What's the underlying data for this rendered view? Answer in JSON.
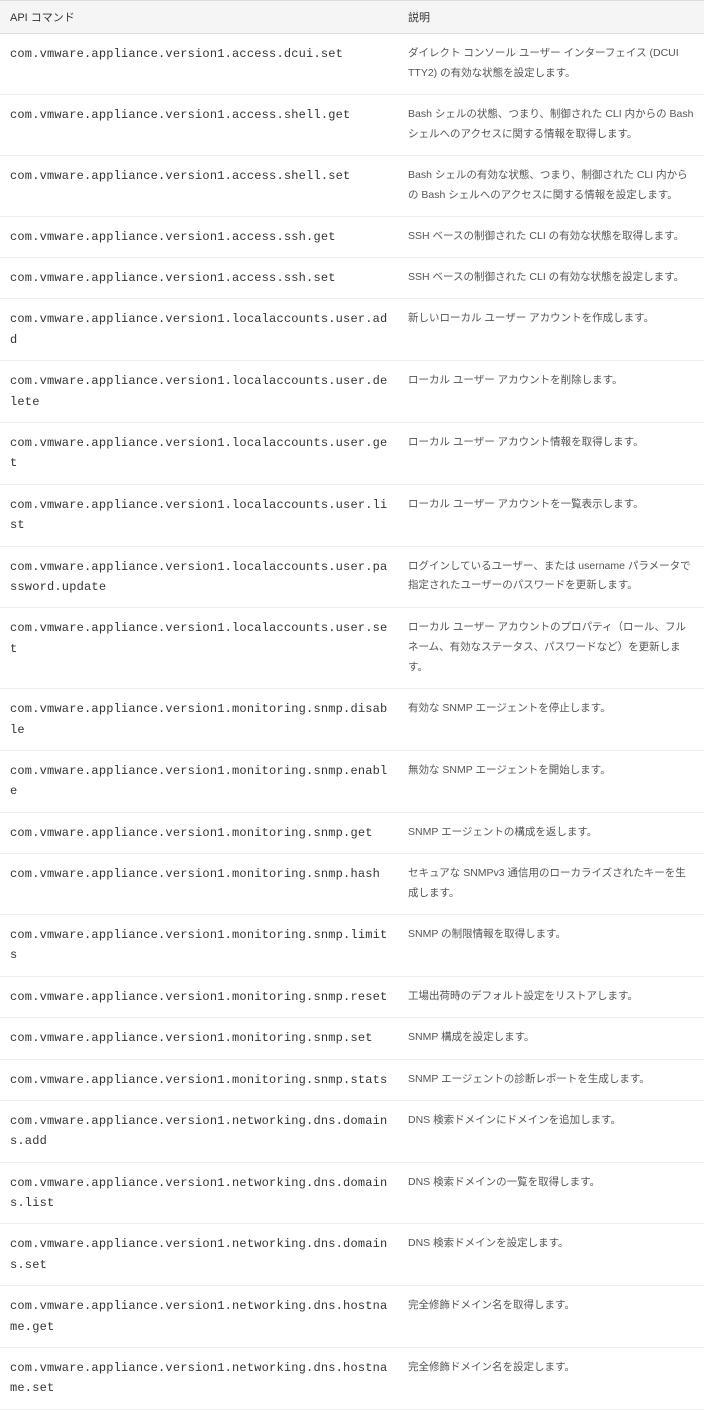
{
  "table": {
    "headers": {
      "command": "API コマンド",
      "description": "説明"
    },
    "rows": [
      {
        "command": "com.vmware.appliance.version1.access.dcui.set",
        "description": "ダイレクト コンソール ユーザー インターフェイス (DCUI TTY2) の有効な状態を設定します。"
      },
      {
        "command": "com.vmware.appliance.version1.access.shell.get",
        "description": "Bash シェルの状態、つまり、制御された CLI 内からの Bash シェルへのアクセスに関する情報を取得します。"
      },
      {
        "command": "com.vmware.appliance.version1.access.shell.set",
        "description": "Bash シェルの有効な状態、つまり、制御された CLI 内からの Bash シェルへのアクセスに関する情報を設定します。"
      },
      {
        "command": "com.vmware.appliance.version1.access.ssh.get",
        "description": "SSH ベースの制御された CLI の有効な状態を取得します。"
      },
      {
        "command": "com.vmware.appliance.version1.access.ssh.set",
        "description": "SSH ベースの制御された CLI の有効な状態を設定します。"
      },
      {
        "command": "com.vmware.appliance.version1.localaccounts.user.add",
        "description": "新しいローカル ユーザー アカウントを作成します。"
      },
      {
        "command": "com.vmware.appliance.version1.localaccounts.user.delete",
        "description": "ローカル ユーザー アカウントを削除します。"
      },
      {
        "command": "com.vmware.appliance.version1.localaccounts.user.get",
        "description": "ローカル ユーザー アカウント情報を取得します。"
      },
      {
        "command": "com.vmware.appliance.version1.localaccounts.user.list",
        "description": "ローカル ユーザー アカウントを一覧表示します。"
      },
      {
        "command": "com.vmware.appliance.version1.localaccounts.user.password.update",
        "description": "ログインしているユーザー、または username パラメータで指定されたユーザーのパスワードを更新します。"
      },
      {
        "command": "com.vmware.appliance.version1.localaccounts.user.set",
        "description": "ローカル ユーザー アカウントのプロパティ（ロール、フル ネーム、有効なステータス、パスワードなど）を更新します。"
      },
      {
        "command": "com.vmware.appliance.version1.monitoring.snmp.disable",
        "description": "有効な SNMP エージェントを停止します。"
      },
      {
        "command": "com.vmware.appliance.version1.monitoring.snmp.enable",
        "description": "無効な SNMP エージェントを開始します。"
      },
      {
        "command": "com.vmware.appliance.version1.monitoring.snmp.get",
        "description": "SNMP エージェントの構成を返します。"
      },
      {
        "command": "com.vmware.appliance.version1.monitoring.snmp.hash",
        "description": "セキュアな SNMPv3 通信用のローカライズされたキーを生成します。"
      },
      {
        "command": "com.vmware.appliance.version1.monitoring.snmp.limits",
        "description": "SNMP の制限情報を取得します。"
      },
      {
        "command": "com.vmware.appliance.version1.monitoring.snmp.reset",
        "description": "工場出荷時のデフォルト設定をリストアします。"
      },
      {
        "command": "com.vmware.appliance.version1.monitoring.snmp.set",
        "description": "SNMP 構成を設定します。"
      },
      {
        "command": "com.vmware.appliance.version1.monitoring.snmp.stats",
        "description": "SNMP エージェントの診断レポートを生成します。"
      },
      {
        "command": "com.vmware.appliance.version1.networking.dns.domains.add",
        "description": "DNS 検索ドメインにドメインを追加します。"
      },
      {
        "command": "com.vmware.appliance.version1.networking.dns.domains.list",
        "description": "DNS 検索ドメインの一覧を取得します。"
      },
      {
        "command": "com.vmware.appliance.version1.networking.dns.domains.set",
        "description": "DNS 検索ドメインを設定します。"
      },
      {
        "command": "com.vmware.appliance.version1.networking.dns.hostname.get",
        "description": "完全修飾ドメイン名を取得します。"
      },
      {
        "command": "com.vmware.appliance.version1.networking.dns.hostname.set",
        "description": "完全修飾ドメイン名を設定します。"
      }
    ]
  }
}
